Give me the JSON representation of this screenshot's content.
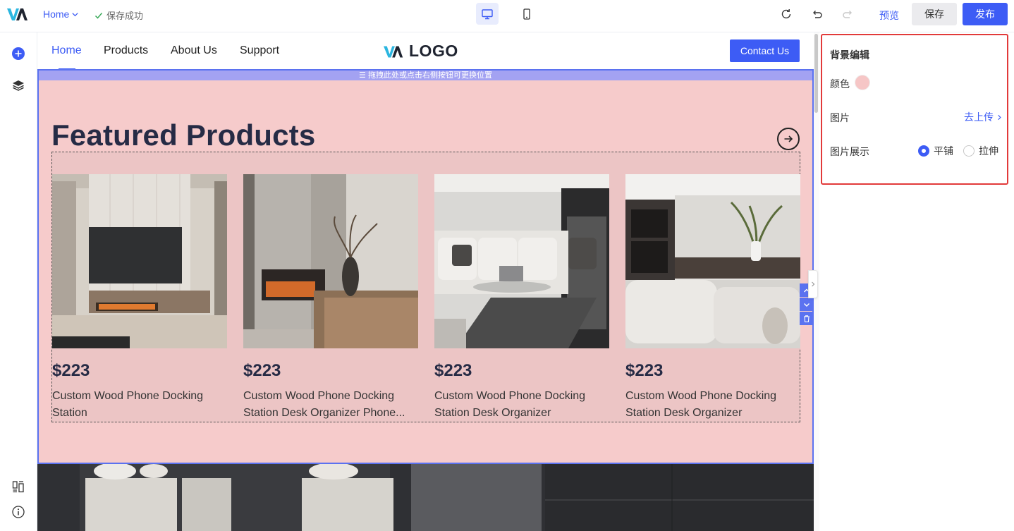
{
  "topbar": {
    "page_select": "Home",
    "save_status": "保存成功",
    "preview": "预览",
    "save": "保存",
    "publish": "发布"
  },
  "site": {
    "nav": [
      "Home",
      "Products",
      "About Us",
      "Support"
    ],
    "logo_text": "LOGO",
    "contact_button": "Contact Us"
  },
  "section": {
    "drag_hint": "☰ 拖拽此处或点击右侧按钮可更换位置",
    "title": "Featured Products",
    "products": [
      {
        "price": "$223",
        "name": "Custom Wood Phone Docking Station"
      },
      {
        "price": "$223",
        "name": "Custom Wood Phone Docking Station Desk Organizer Phone..."
      },
      {
        "price": "$223",
        "name": "Custom Wood Phone Docking Station Desk Organizer"
      },
      {
        "price": "$223",
        "name": "Custom Wood Phone Docking Station Desk Organizer"
      }
    ]
  },
  "panel": {
    "title": "背景编辑",
    "color_label": "颜色",
    "color_value": "#f6c6c6",
    "image_label": "图片",
    "upload_link": "去上传",
    "display_label": "图片展示",
    "display_options": [
      "平铺",
      "拉伸"
    ],
    "display_selected": "平铺"
  },
  "colors": {
    "accent": "#3d5cf5",
    "section_bg": "#f6cbcb",
    "highlight_border": "#e23a3a"
  }
}
